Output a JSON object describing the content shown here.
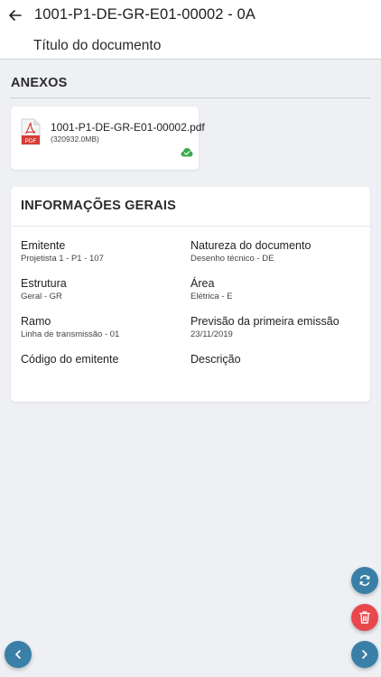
{
  "header": {
    "document_code": "1001-P1-DE-GR-E01-00002 - 0A",
    "document_title": "Título do documento"
  },
  "attachments": {
    "section_title": "ANEXOS",
    "items": [
      {
        "file_name": "1001-P1-DE-GR-E01-00002.pdf",
        "file_size": "(320932.0MB)",
        "icon": "pdf-icon",
        "status_icon": "cloud-check-icon"
      }
    ]
  },
  "general_info": {
    "section_title": "INFORMAÇÕES GERAIS",
    "fields": {
      "emitente": {
        "label": "Emitente",
        "value": "Projetista 1 - P1 - 107"
      },
      "natureza": {
        "label": "Natureza do documento",
        "value": "Desenho técnico - DE"
      },
      "estrutura": {
        "label": "Estrutura",
        "value": "Geral - GR"
      },
      "area": {
        "label": "Área",
        "value": "Elétrica - E"
      },
      "ramo": {
        "label": "Ramo",
        "value": "Linha de transmissão - 01"
      },
      "previsao": {
        "label": "Previsão da primeira emissão",
        "value": "23/11/2019"
      },
      "codigo_emitente": {
        "label": "Código do emitente",
        "value": ""
      },
      "descricao": {
        "label": "Descrição",
        "value": ""
      }
    }
  },
  "actions": {
    "refresh_icon": "refresh-icon",
    "delete_icon": "trash-icon",
    "next_icon": "chevron-right-icon",
    "prev_icon": "chevron-left-icon"
  },
  "colors": {
    "accent": "#3a7fa8",
    "danger": "#e8474c",
    "success": "#3daa4e",
    "pdf_red": "#d63b35",
    "background": "#eef0f4"
  }
}
